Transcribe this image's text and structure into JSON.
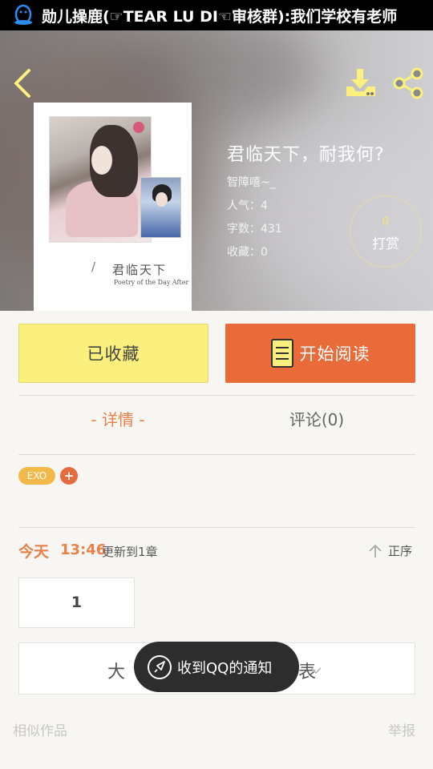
{
  "status_bar": {
    "notification_text": "勋儿操鹿(☞TEAR LU DI☜审核群):我们学校有老师"
  },
  "colors": {
    "accent_orange": "#ea6b3a",
    "collect_yellow": "#fbf07d",
    "tab_active": "#e5834a"
  },
  "header": {
    "back_icon": "chevron-left-icon",
    "download_icon": "download-icon",
    "share_icon": "share-icon"
  },
  "cover": {
    "title": "君临天下",
    "slash": "/",
    "subtitle": "Poetry of the Day After"
  },
  "book": {
    "title": "君临天下，耐我何?",
    "author": "智障嘻~_",
    "popularity": "人气：4",
    "word_count": "字数：431",
    "favorites": "收藏：0",
    "tip_count": "0",
    "tip_label": "打赏"
  },
  "actions": {
    "collect_label": "已收藏",
    "read_label": "开始阅读"
  },
  "tabs": {
    "detail": "- 详情 -",
    "comment": "评论(0)"
  },
  "tags": {
    "items": [
      "EXO"
    ],
    "add": "+"
  },
  "update": {
    "day": "今天",
    "time": "13:46",
    "text": "更新到1章",
    "sort_label": "正序"
  },
  "chapters": {
    "first": "1",
    "expand_label": "大",
    "expand_suffix": "表"
  },
  "toast": {
    "text": "收到QQ的通知"
  },
  "footer": {
    "similar": "相似作品",
    "report": "举报"
  }
}
